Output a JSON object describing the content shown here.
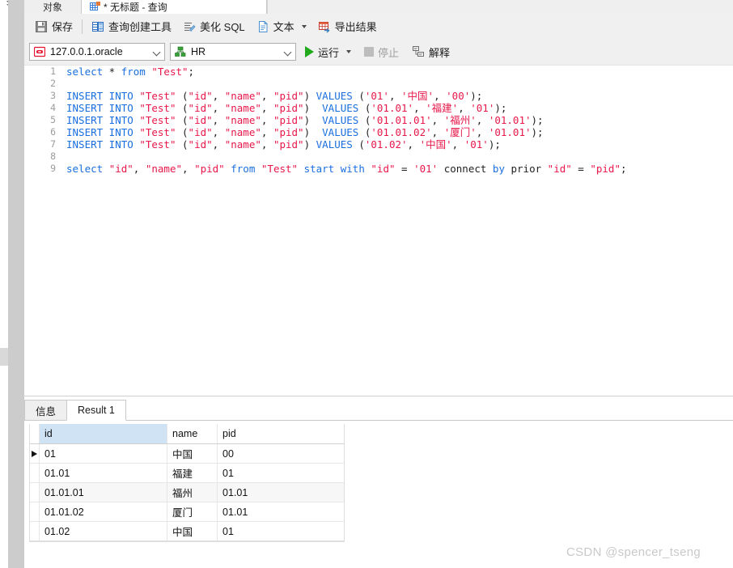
{
  "window": {
    "tabs": [
      {
        "label": "对象",
        "active": false,
        "icon": "objects-icon"
      },
      {
        "label": "* 无标题 - 查询",
        "active": true,
        "icon": "query-grid-icon"
      }
    ]
  },
  "toolbar": {
    "items": [
      {
        "label": "保存",
        "icon": "save-disk-icon",
        "caret": false
      },
      {
        "label": "查询创建工具",
        "icon": "query-builder-icon",
        "caret": false
      },
      {
        "label": "美化 SQL",
        "icon": "beautify-sql-icon",
        "caret": false
      },
      {
        "label": "文本",
        "icon": "text-file-icon",
        "caret": true
      },
      {
        "label": "导出结果",
        "icon": "export-results-icon",
        "caret": false
      }
    ]
  },
  "connbar": {
    "connection": {
      "value": "127.0.0.1.oracle",
      "icon": "oracle-db-icon"
    },
    "schema": {
      "value": "HR",
      "icon": "schema-tree-icon"
    },
    "run": {
      "label": "运行",
      "icon": "play-icon",
      "caret": true,
      "disabled": false
    },
    "stop": {
      "label": "停止",
      "icon": "stop-square-icon",
      "disabled": true
    },
    "explain": {
      "label": "解释",
      "icon": "explain-plan-icon",
      "disabled": false
    }
  },
  "editor": {
    "line_numbers": [
      "1",
      "2",
      "3",
      "4",
      "5",
      "6",
      "7",
      "8",
      "9"
    ],
    "lines": [
      [
        {
          "t": "select",
          "c": "kw"
        },
        {
          "t": " * ",
          "c": "pl"
        },
        {
          "t": "from",
          "c": "kw"
        },
        {
          "t": " ",
          "c": "pl"
        },
        {
          "t": "\"Test\"",
          "c": "id"
        },
        {
          "t": ";",
          "c": "pl"
        }
      ],
      [],
      [
        {
          "t": "INSERT INTO",
          "c": "kw"
        },
        {
          "t": " ",
          "c": "pl"
        },
        {
          "t": "\"Test\"",
          "c": "id"
        },
        {
          "t": " (",
          "c": "pl"
        },
        {
          "t": "\"id\"",
          "c": "id"
        },
        {
          "t": ", ",
          "c": "pl"
        },
        {
          "t": "\"name\"",
          "c": "id"
        },
        {
          "t": ", ",
          "c": "pl"
        },
        {
          "t": "\"pid\"",
          "c": "id"
        },
        {
          "t": ") ",
          "c": "pl"
        },
        {
          "t": "VALUES",
          "c": "kw"
        },
        {
          "t": " (",
          "c": "pl"
        },
        {
          "t": "'01'",
          "c": "str"
        },
        {
          "t": ", ",
          "c": "pl"
        },
        {
          "t": "'中国'",
          "c": "str"
        },
        {
          "t": ", ",
          "c": "pl"
        },
        {
          "t": "'00'",
          "c": "str"
        },
        {
          "t": ");",
          "c": "pl"
        }
      ],
      [
        {
          "t": "INSERT INTO",
          "c": "kw"
        },
        {
          "t": " ",
          "c": "pl"
        },
        {
          "t": "\"Test\"",
          "c": "id"
        },
        {
          "t": " (",
          "c": "pl"
        },
        {
          "t": "\"id\"",
          "c": "id"
        },
        {
          "t": ", ",
          "c": "pl"
        },
        {
          "t": "\"name\"",
          "c": "id"
        },
        {
          "t": ", ",
          "c": "pl"
        },
        {
          "t": "\"pid\"",
          "c": "id"
        },
        {
          "t": ")  ",
          "c": "pl"
        },
        {
          "t": "VALUES",
          "c": "kw"
        },
        {
          "t": " (",
          "c": "pl"
        },
        {
          "t": "'01.01'",
          "c": "str"
        },
        {
          "t": ", ",
          "c": "pl"
        },
        {
          "t": "'福建'",
          "c": "str"
        },
        {
          "t": ", ",
          "c": "pl"
        },
        {
          "t": "'01'",
          "c": "str"
        },
        {
          "t": ");",
          "c": "pl"
        }
      ],
      [
        {
          "t": "INSERT INTO",
          "c": "kw"
        },
        {
          "t": " ",
          "c": "pl"
        },
        {
          "t": "\"Test\"",
          "c": "id"
        },
        {
          "t": " (",
          "c": "pl"
        },
        {
          "t": "\"id\"",
          "c": "id"
        },
        {
          "t": ", ",
          "c": "pl"
        },
        {
          "t": "\"name\"",
          "c": "id"
        },
        {
          "t": ", ",
          "c": "pl"
        },
        {
          "t": "\"pid\"",
          "c": "id"
        },
        {
          "t": ")  ",
          "c": "pl"
        },
        {
          "t": "VALUES",
          "c": "kw"
        },
        {
          "t": " (",
          "c": "pl"
        },
        {
          "t": "'01.01.01'",
          "c": "str"
        },
        {
          "t": ", ",
          "c": "pl"
        },
        {
          "t": "'福州'",
          "c": "str"
        },
        {
          "t": ", ",
          "c": "pl"
        },
        {
          "t": "'01.01'",
          "c": "str"
        },
        {
          "t": ");",
          "c": "pl"
        }
      ],
      [
        {
          "t": "INSERT INTO",
          "c": "kw"
        },
        {
          "t": " ",
          "c": "pl"
        },
        {
          "t": "\"Test\"",
          "c": "id"
        },
        {
          "t": " (",
          "c": "pl"
        },
        {
          "t": "\"id\"",
          "c": "id"
        },
        {
          "t": ", ",
          "c": "pl"
        },
        {
          "t": "\"name\"",
          "c": "id"
        },
        {
          "t": ", ",
          "c": "pl"
        },
        {
          "t": "\"pid\"",
          "c": "id"
        },
        {
          "t": ")  ",
          "c": "pl"
        },
        {
          "t": "VALUES",
          "c": "kw"
        },
        {
          "t": " (",
          "c": "pl"
        },
        {
          "t": "'01.01.02'",
          "c": "str"
        },
        {
          "t": ", ",
          "c": "pl"
        },
        {
          "t": "'厦门'",
          "c": "str"
        },
        {
          "t": ", ",
          "c": "pl"
        },
        {
          "t": "'01.01'",
          "c": "str"
        },
        {
          "t": ");",
          "c": "pl"
        }
      ],
      [
        {
          "t": "INSERT INTO",
          "c": "kw"
        },
        {
          "t": " ",
          "c": "pl"
        },
        {
          "t": "\"Test\"",
          "c": "id"
        },
        {
          "t": " (",
          "c": "pl"
        },
        {
          "t": "\"id\"",
          "c": "id"
        },
        {
          "t": ", ",
          "c": "pl"
        },
        {
          "t": "\"name\"",
          "c": "id"
        },
        {
          "t": ", ",
          "c": "pl"
        },
        {
          "t": "\"pid\"",
          "c": "id"
        },
        {
          "t": ") ",
          "c": "pl"
        },
        {
          "t": "VALUES",
          "c": "kw"
        },
        {
          "t": " (",
          "c": "pl"
        },
        {
          "t": "'01.02'",
          "c": "str"
        },
        {
          "t": ", ",
          "c": "pl"
        },
        {
          "t": "'中国'",
          "c": "str"
        },
        {
          "t": ", ",
          "c": "pl"
        },
        {
          "t": "'01'",
          "c": "str"
        },
        {
          "t": ");",
          "c": "pl"
        }
      ],
      [],
      [
        {
          "t": "select",
          "c": "kw"
        },
        {
          "t": " ",
          "c": "pl"
        },
        {
          "t": "\"id\"",
          "c": "id"
        },
        {
          "t": ", ",
          "c": "pl"
        },
        {
          "t": "\"name\"",
          "c": "id"
        },
        {
          "t": ", ",
          "c": "pl"
        },
        {
          "t": "\"pid\"",
          "c": "id"
        },
        {
          "t": " ",
          "c": "pl"
        },
        {
          "t": "from",
          "c": "kw"
        },
        {
          "t": " ",
          "c": "pl"
        },
        {
          "t": "\"Test\"",
          "c": "id"
        },
        {
          "t": " ",
          "c": "pl"
        },
        {
          "t": "start",
          "c": "kw"
        },
        {
          "t": " ",
          "c": "pl"
        },
        {
          "t": "with",
          "c": "kw"
        },
        {
          "t": " ",
          "c": "pl"
        },
        {
          "t": "\"id\"",
          "c": "id"
        },
        {
          "t": " = ",
          "c": "pl"
        },
        {
          "t": "'01'",
          "c": "str"
        },
        {
          "t": " connect ",
          "c": "pl"
        },
        {
          "t": "by",
          "c": "kw"
        },
        {
          "t": " prior ",
          "c": "pl"
        },
        {
          "t": "\"id\"",
          "c": "id"
        },
        {
          "t": " = ",
          "c": "pl"
        },
        {
          "t": "\"pid\"",
          "c": "id"
        },
        {
          "t": ";",
          "c": "pl"
        }
      ]
    ]
  },
  "results": {
    "tabs": [
      {
        "label": "信息",
        "active": false
      },
      {
        "label": "Result 1",
        "active": true
      }
    ],
    "grid": {
      "columns": [
        "id",
        "name",
        "pid"
      ],
      "selected_column": "id",
      "current_row_index": 0,
      "rows": [
        {
          "id": "01",
          "name": "中国",
          "pid": "00"
        },
        {
          "id": "01.01",
          "name": "福建",
          "pid": "01"
        },
        {
          "id": "01.01.01",
          "name": "福州",
          "pid": "01.01"
        },
        {
          "id": "01.01.02",
          "name": "厦门",
          "pid": "01.01"
        },
        {
          "id": "01.02",
          "name": "中国",
          "pid": "01"
        }
      ]
    }
  },
  "watermark": {
    "text": "CSDN @spencer_tseng"
  },
  "colors": {
    "accent_green": "#22a81c",
    "keyword_blue": "#1a6fe0",
    "identifier_red": "#e8174a",
    "selected_header": "#cfe3f5",
    "chrome_gray": "#f0f0f0",
    "dock_gray": "#cccccc"
  }
}
